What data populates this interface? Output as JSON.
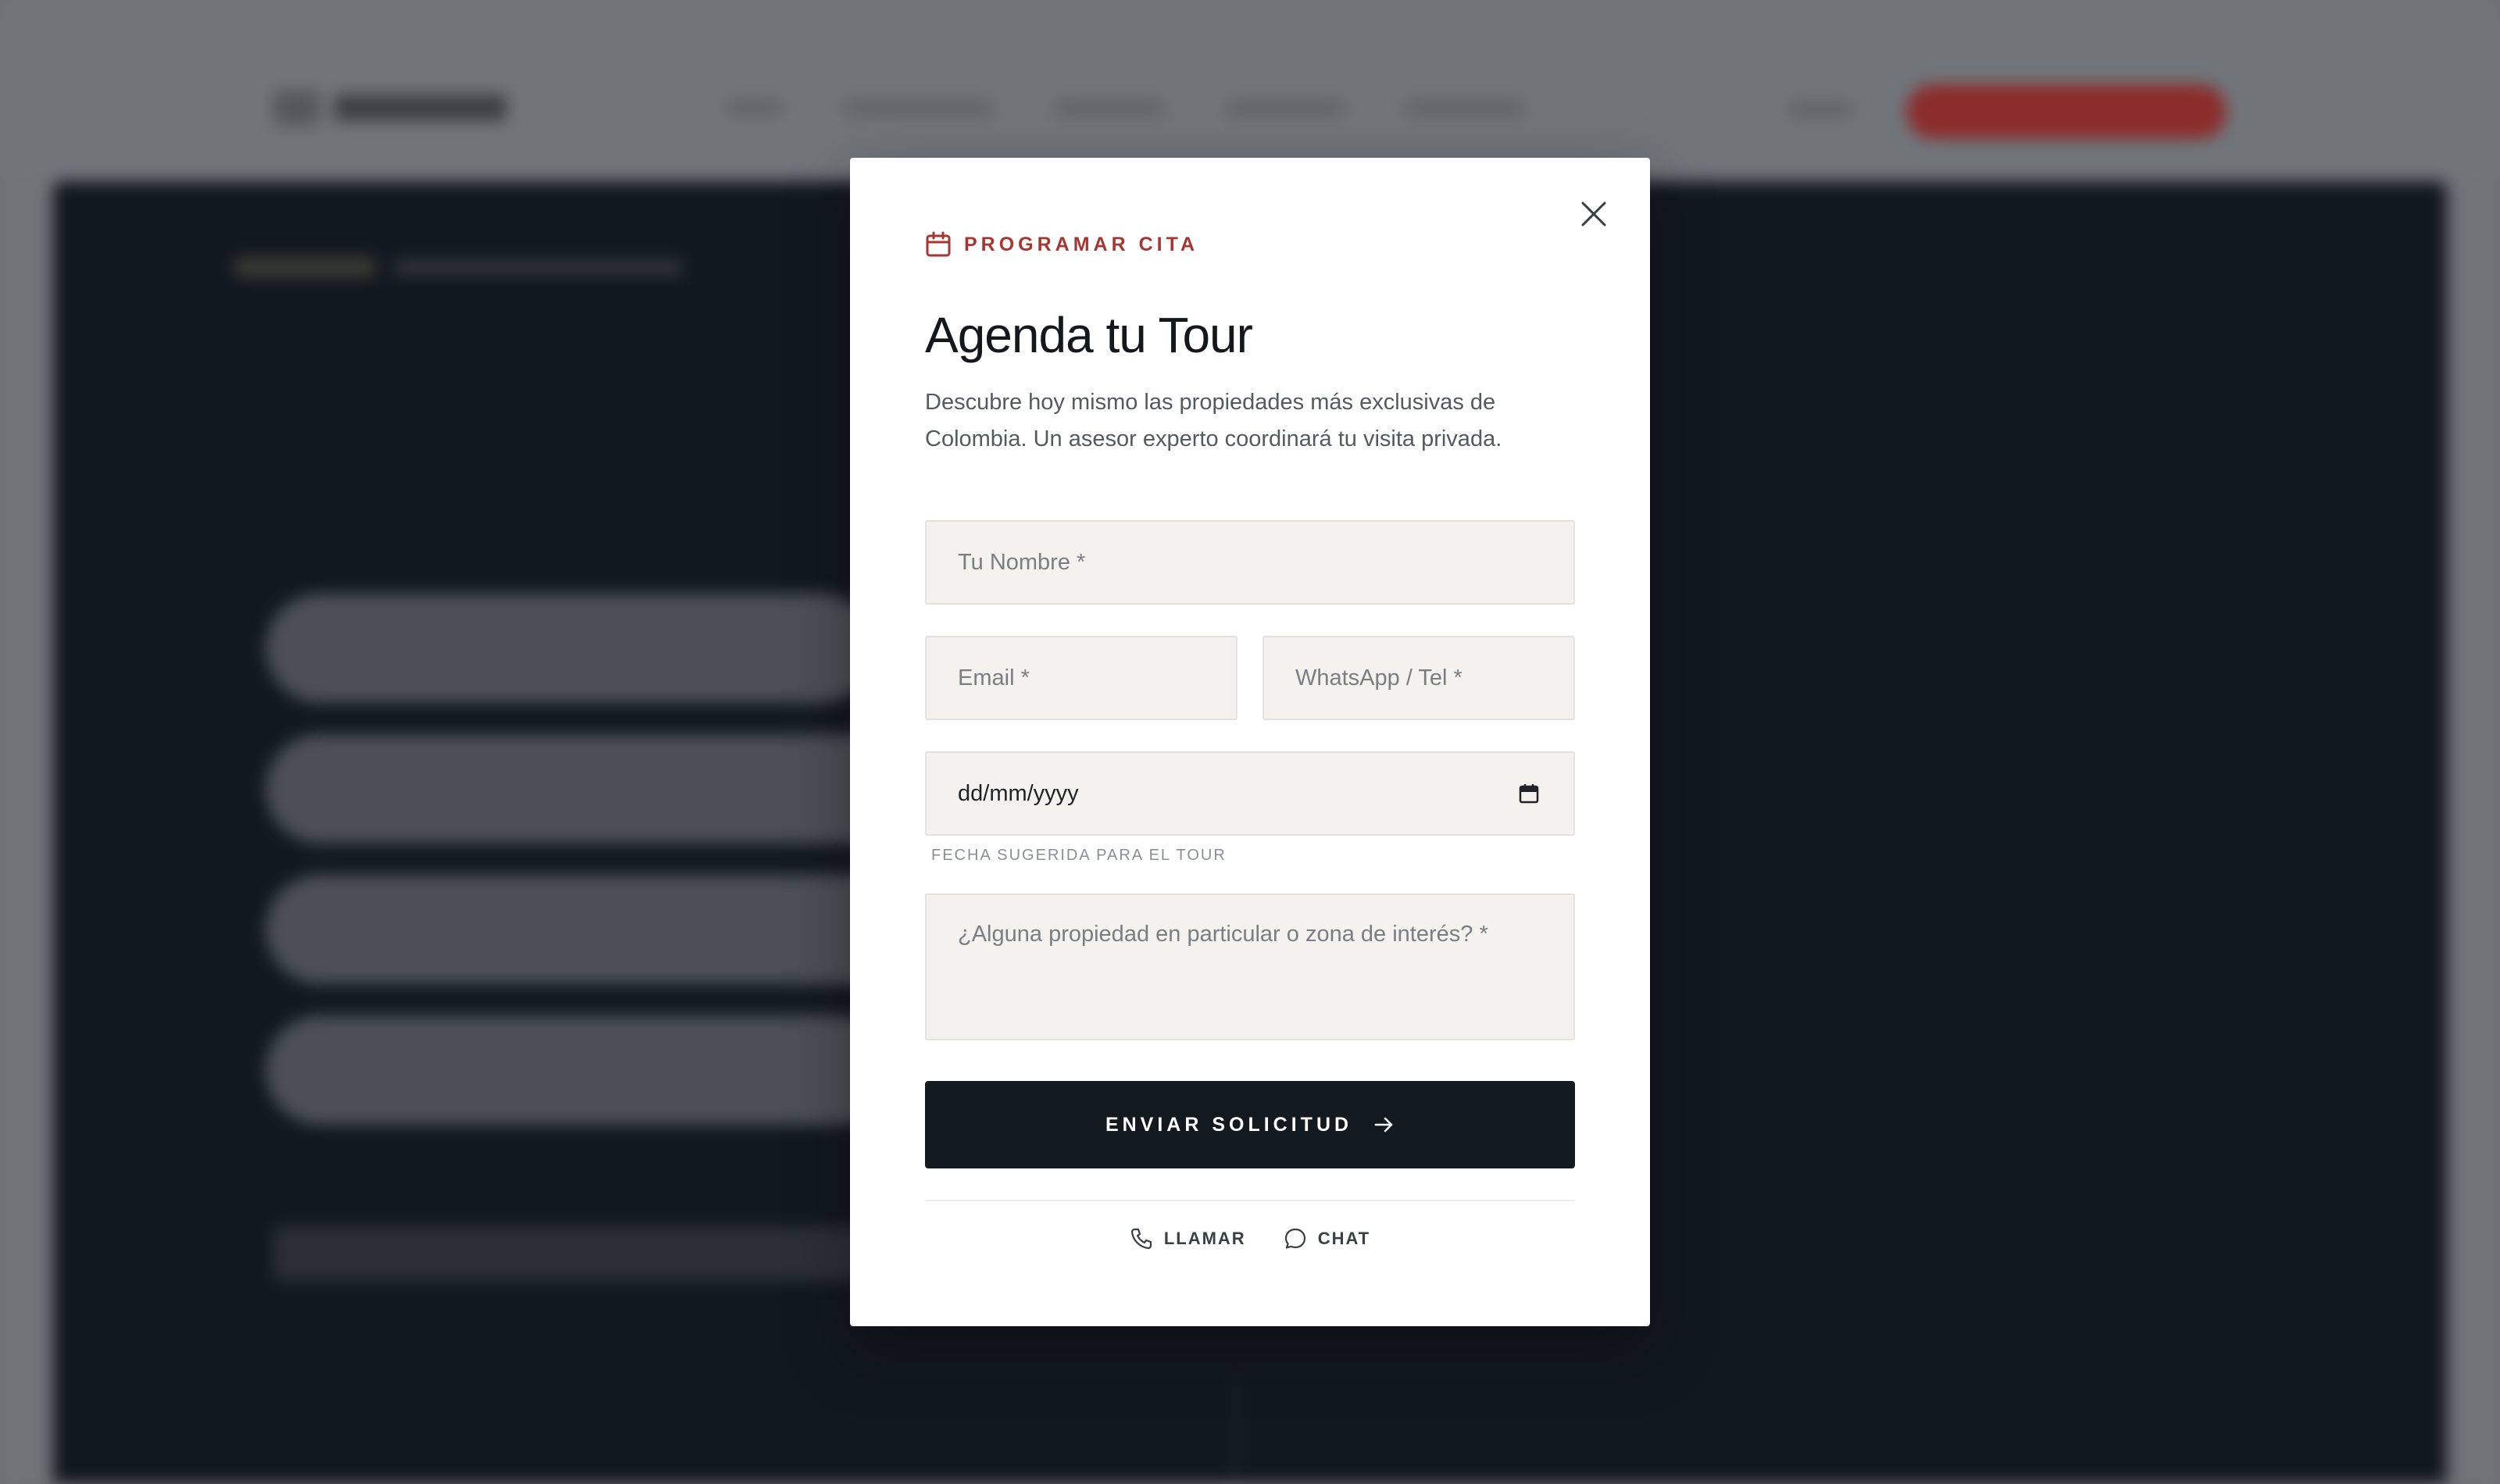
{
  "modal": {
    "eyebrow": "PROGRAMAR CITA",
    "title": "Agenda tu Tour",
    "description": "Descubre hoy mismo las propiedades más exclusivas de Colombia. Un asesor experto coordinará tu visita privada.",
    "fields": {
      "name_placeholder": "Tu Nombre *",
      "email_placeholder": "Email *",
      "phone_placeholder": "WhatsApp / Tel *",
      "date_value": "dd/mm/yyyy",
      "date_hint": "FECHA SUGERIDA PARA EL TOUR",
      "notes_placeholder": "¿Alguna propiedad en particular o zona de interés? *"
    },
    "submit_label": "ENVIAR SOLICITUD",
    "contact": {
      "call_label": "LLAMAR",
      "chat_label": "CHAT"
    }
  },
  "icons": {
    "eyebrow": "calendar-icon",
    "close": "close-icon",
    "date_picker": "calendar-picker-icon",
    "submit": "arrow-right-icon",
    "call": "phone-icon",
    "chat": "chat-bubble-icon"
  },
  "colors": {
    "accent": "#a8352f",
    "primary_button": "#121a20",
    "field_background": "#f3f2ee",
    "overlay": "#6d7276"
  }
}
